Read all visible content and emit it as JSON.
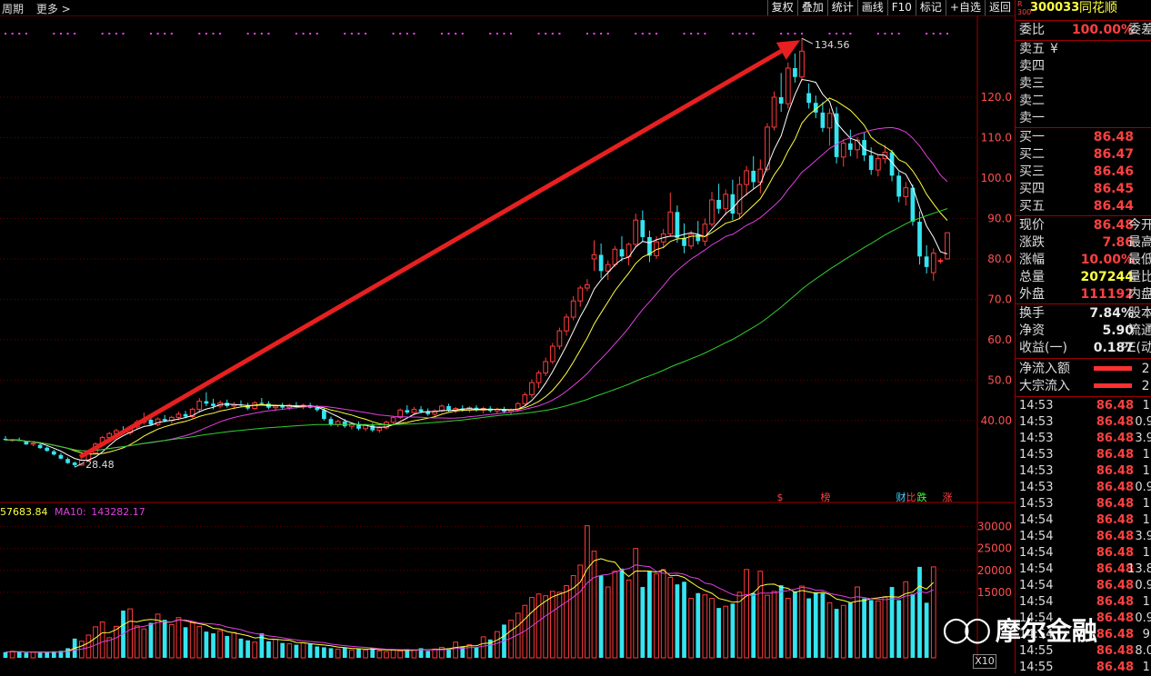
{
  "toolbar": {
    "left_items": [
      "周期",
      "更多 >"
    ],
    "buttons": [
      "复权",
      "叠加",
      "统计",
      "画线",
      "F10",
      "标记",
      "+自选",
      "返回"
    ]
  },
  "stock": {
    "badge_top": "R",
    "badge_bottom": "300",
    "code": "300033",
    "name": "同花顺"
  },
  "panel": {
    "weibi_label": "委比",
    "weibi_value": "100.00%",
    "weicha_label": "委差",
    "sell_labels": [
      "卖五",
      "卖四",
      "卖三",
      "卖二",
      "卖一"
    ],
    "sell_currency": "¥",
    "buy": [
      {
        "label": "买一",
        "price": "86.48"
      },
      {
        "label": "买二",
        "price": "86.47"
      },
      {
        "label": "买三",
        "price": "86.46"
      },
      {
        "label": "买四",
        "price": "86.45"
      },
      {
        "label": "买五",
        "price": "86.44"
      }
    ],
    "quote": [
      {
        "label": "现价",
        "value": "86.48",
        "tail": "今开"
      },
      {
        "label": "涨跌",
        "value": "7.86",
        "tail": "最高"
      },
      {
        "label": "涨幅",
        "value": "10.00%",
        "tail": "最低"
      },
      {
        "label": "总量",
        "value": "207244",
        "tail": "量比"
      },
      {
        "label": "外盘",
        "value": "111192",
        "tail": "内盘"
      }
    ],
    "fin": [
      {
        "label": "换手",
        "value": "7.84%",
        "tail": "股本"
      },
      {
        "label": "净资",
        "value": "5.90",
        "tail": "流通"
      },
      {
        "label": "收益(一)",
        "value": "0.187",
        "tail": "PE(动"
      }
    ],
    "flow": [
      {
        "label": "净流入额",
        "tail": "2."
      },
      {
        "label": "大宗流入",
        "tail": "2."
      }
    ],
    "ticks": [
      {
        "time": "14:53",
        "price": "86.48",
        "vol": "1."
      },
      {
        "time": "14:53",
        "price": "86.48",
        "vol": "0.9"
      },
      {
        "time": "14:53",
        "price": "86.48",
        "vol": "3.9"
      },
      {
        "time": "14:53",
        "price": "86.48",
        "vol": "1."
      },
      {
        "time": "14:53",
        "price": "86.48",
        "vol": "1."
      },
      {
        "time": "14:53",
        "price": "86.48",
        "vol": "0.9"
      },
      {
        "time": "14:53",
        "price": "86.48",
        "vol": "1."
      },
      {
        "time": "14:54",
        "price": "86.48",
        "vol": "1."
      },
      {
        "time": "14:54",
        "price": "86.48",
        "vol": "3.9"
      },
      {
        "time": "14:54",
        "price": "86.48",
        "vol": "1."
      },
      {
        "time": "14:54",
        "price": "86.48",
        "vol": "13.8"
      },
      {
        "time": "14:54",
        "price": "86.48",
        "vol": "0.9"
      },
      {
        "time": "14:54",
        "price": "86.48",
        "vol": "1."
      },
      {
        "time": "14:54",
        "price": "86.48",
        "vol": "0.9"
      },
      {
        "time": "14:54",
        "price": "86.48",
        "vol": "9."
      },
      {
        "time": "14:55",
        "price": "86.48",
        "vol": "8.0"
      },
      {
        "time": "14:55",
        "price": "86.48",
        "vol": "1."
      }
    ]
  },
  "colors": {
    "up": "#ff3b3b",
    "down": "#34e5f0",
    "ma5": "#ffffff",
    "ma10": "#ffff3c",
    "ma20": "#e040e0",
    "ma60": "#30d030",
    "arrow": "#e62020",
    "grid": "#6a0000"
  },
  "chart_data": {
    "type": "candlestick",
    "price_axis": {
      "ticks": [
        "120.0",
        "110.0",
        "100.0",
        "90.0",
        "80.0",
        "70.0",
        "60.0",
        "50.0",
        "40.00"
      ],
      "range": [
        22,
        140
      ]
    },
    "volume_axis": {
      "ticks": [
        "30000",
        "25000",
        "20000",
        "15000"
      ],
      "range": [
        0,
        32000
      ]
    },
    "annotations": {
      "high": "134.56",
      "low": "28.48"
    },
    "event_markers": [
      "$",
      "榜",
      "财",
      "比",
      "跌",
      "涨"
    ],
    "volume_legend": [
      {
        "name": "",
        "value": "57683.84"
      },
      {
        "name": "MA10:",
        "value": "143282.17"
      }
    ],
    "volume_multiplier": "X10",
    "candles": [
      {
        "o": 35.5,
        "h": 36.2,
        "l": 35.0,
        "c": 35.2
      },
      {
        "o": 35.1,
        "h": 35.5,
        "l": 34.8,
        "c": 35.3
      },
      {
        "o": 35.2,
        "h": 35.8,
        "l": 34.9,
        "c": 35.0
      },
      {
        "o": 34.8,
        "h": 35.0,
        "l": 34.0,
        "c": 34.1
      },
      {
        "o": 34.2,
        "h": 34.6,
        "l": 33.7,
        "c": 34.4
      },
      {
        "o": 34.0,
        "h": 34.3,
        "l": 33.0,
        "c": 33.2
      },
      {
        "o": 33.3,
        "h": 33.6,
        "l": 32.3,
        "c": 32.5
      },
      {
        "o": 32.4,
        "h": 32.8,
        "l": 31.4,
        "c": 31.6
      },
      {
        "o": 31.5,
        "h": 32.0,
        "l": 30.4,
        "c": 30.6
      },
      {
        "o": 30.5,
        "h": 30.9,
        "l": 29.3,
        "c": 29.5
      },
      {
        "o": 29.6,
        "h": 29.9,
        "l": 28.48,
        "c": 29.0
      },
      {
        "o": 29.0,
        "h": 30.5,
        "l": 28.8,
        "c": 30.2
      },
      {
        "o": 30.2,
        "h": 32.4,
        "l": 30.0,
        "c": 32.1
      },
      {
        "o": 32.0,
        "h": 34.6,
        "l": 31.8,
        "c": 34.2
      },
      {
        "o": 34.2,
        "h": 36.2,
        "l": 33.6,
        "c": 35.8
      },
      {
        "o": 35.8,
        "h": 37.2,
        "l": 35.0,
        "c": 36.8
      },
      {
        "o": 36.8,
        "h": 38.0,
        "l": 36.0,
        "c": 37.5
      },
      {
        "o": 37.5,
        "h": 38.6,
        "l": 36.6,
        "c": 37.0
      },
      {
        "o": 37.0,
        "h": 38.8,
        "l": 36.4,
        "c": 38.4
      },
      {
        "o": 38.4,
        "h": 40.2,
        "l": 37.8,
        "c": 39.6
      },
      {
        "o": 39.6,
        "h": 42.0,
        "l": 39.0,
        "c": 40.2
      },
      {
        "o": 40.2,
        "h": 41.0,
        "l": 38.8,
        "c": 39.0
      },
      {
        "o": 39.0,
        "h": 40.8,
        "l": 38.6,
        "c": 40.4
      },
      {
        "o": 40.4,
        "h": 41.4,
        "l": 39.6,
        "c": 40.0
      },
      {
        "o": 40.0,
        "h": 41.2,
        "l": 39.2,
        "c": 40.8
      },
      {
        "o": 40.8,
        "h": 42.2,
        "l": 40.2,
        "c": 41.6
      },
      {
        "o": 41.6,
        "h": 42.4,
        "l": 40.6,
        "c": 41.0
      },
      {
        "o": 41.0,
        "h": 43.2,
        "l": 40.6,
        "c": 42.8
      },
      {
        "o": 42.8,
        "h": 45.6,
        "l": 42.0,
        "c": 44.8
      },
      {
        "o": 44.8,
        "h": 47.0,
        "l": 43.6,
        "c": 44.2
      },
      {
        "o": 44.2,
        "h": 45.4,
        "l": 42.8,
        "c": 43.6
      },
      {
        "o": 43.6,
        "h": 45.0,
        "l": 43.0,
        "c": 44.4
      },
      {
        "o": 44.4,
        "h": 45.2,
        "l": 43.2,
        "c": 43.6
      },
      {
        "o": 43.6,
        "h": 44.6,
        "l": 42.8,
        "c": 44.0
      },
      {
        "o": 44.0,
        "h": 45.0,
        "l": 43.4,
        "c": 43.8
      },
      {
        "o": 43.8,
        "h": 44.4,
        "l": 42.6,
        "c": 43.0
      },
      {
        "o": 43.0,
        "h": 44.8,
        "l": 42.6,
        "c": 44.4
      },
      {
        "o": 44.4,
        "h": 45.6,
        "l": 43.8,
        "c": 44.2
      },
      {
        "o": 44.2,
        "h": 44.8,
        "l": 42.8,
        "c": 43.2
      },
      {
        "o": 43.2,
        "h": 44.0,
        "l": 42.4,
        "c": 43.6
      },
      {
        "o": 43.6,
        "h": 44.4,
        "l": 42.8,
        "c": 43.2
      },
      {
        "o": 43.2,
        "h": 44.2,
        "l": 42.6,
        "c": 43.8
      },
      {
        "o": 43.8,
        "h": 44.6,
        "l": 43.0,
        "c": 43.4
      },
      {
        "o": 43.4,
        "h": 44.2,
        "l": 42.8,
        "c": 43.8
      },
      {
        "o": 43.8,
        "h": 44.4,
        "l": 43.0,
        "c": 43.2
      },
      {
        "o": 43.2,
        "h": 43.8,
        "l": 42.2,
        "c": 42.6
      },
      {
        "o": 42.6,
        "h": 43.0,
        "l": 40.0,
        "c": 40.4
      },
      {
        "o": 40.4,
        "h": 41.0,
        "l": 38.6,
        "c": 39.0
      },
      {
        "o": 39.0,
        "h": 40.2,
        "l": 38.4,
        "c": 39.8
      },
      {
        "o": 39.8,
        "h": 40.4,
        "l": 38.2,
        "c": 38.6
      },
      {
        "o": 38.6,
        "h": 39.6,
        "l": 37.8,
        "c": 39.2
      },
      {
        "o": 39.2,
        "h": 39.8,
        "l": 37.6,
        "c": 38.0
      },
      {
        "o": 38.0,
        "h": 39.2,
        "l": 37.4,
        "c": 38.8
      },
      {
        "o": 38.8,
        "h": 39.4,
        "l": 37.2,
        "c": 37.6
      },
      {
        "o": 37.6,
        "h": 38.6,
        "l": 37.0,
        "c": 38.2
      },
      {
        "o": 38.2,
        "h": 40.0,
        "l": 37.8,
        "c": 39.6
      },
      {
        "o": 39.6,
        "h": 41.2,
        "l": 39.0,
        "c": 40.8
      },
      {
        "o": 40.8,
        "h": 43.0,
        "l": 40.4,
        "c": 42.6
      },
      {
        "o": 42.6,
        "h": 43.8,
        "l": 41.6,
        "c": 42.0
      },
      {
        "o": 42.0,
        "h": 43.4,
        "l": 41.4,
        "c": 42.8
      },
      {
        "o": 42.8,
        "h": 43.6,
        "l": 41.8,
        "c": 42.2
      },
      {
        "o": 42.2,
        "h": 43.0,
        "l": 41.2,
        "c": 41.6
      },
      {
        "o": 41.6,
        "h": 42.8,
        "l": 41.0,
        "c": 42.4
      },
      {
        "o": 42.4,
        "h": 44.0,
        "l": 42.0,
        "c": 43.6
      },
      {
        "o": 43.6,
        "h": 44.2,
        "l": 42.2,
        "c": 42.6
      },
      {
        "o": 42.6,
        "h": 43.4,
        "l": 41.8,
        "c": 43.0
      },
      {
        "o": 43.0,
        "h": 43.8,
        "l": 42.2,
        "c": 42.6
      },
      {
        "o": 42.6,
        "h": 43.6,
        "l": 42.0,
        "c": 43.2
      },
      {
        "o": 43.2,
        "h": 43.8,
        "l": 42.2,
        "c": 42.6
      },
      {
        "o": 42.6,
        "h": 43.4,
        "l": 41.8,
        "c": 43.0
      },
      {
        "o": 43.0,
        "h": 43.6,
        "l": 42.0,
        "c": 42.4
      },
      {
        "o": 42.4,
        "h": 43.2,
        "l": 41.6,
        "c": 42.8
      },
      {
        "o": 42.8,
        "h": 43.4,
        "l": 41.8,
        "c": 42.2
      },
      {
        "o": 42.2,
        "h": 43.0,
        "l": 41.4,
        "c": 42.6
      },
      {
        "o": 42.6,
        "h": 44.6,
        "l": 42.2,
        "c": 44.2
      },
      {
        "o": 44.2,
        "h": 47.0,
        "l": 43.8,
        "c": 46.4
      },
      {
        "o": 46.4,
        "h": 50.2,
        "l": 45.6,
        "c": 49.4
      },
      {
        "o": 49.4,
        "h": 52.4,
        "l": 48.0,
        "c": 51.8
      },
      {
        "o": 51.8,
        "h": 55.6,
        "l": 51.0,
        "c": 54.6
      },
      {
        "o": 54.6,
        "h": 59.2,
        "l": 54.0,
        "c": 58.4
      },
      {
        "o": 58.4,
        "h": 63.0,
        "l": 57.6,
        "c": 62.2
      },
      {
        "o": 62.2,
        "h": 66.4,
        "l": 61.0,
        "c": 65.6
      },
      {
        "o": 65.6,
        "h": 70.8,
        "l": 64.8,
        "c": 69.6
      },
      {
        "o": 69.6,
        "h": 73.4,
        "l": 68.2,
        "c": 72.8
      },
      {
        "o": 72.8,
        "h": 75.0,
        "l": 72.0,
        "c": 73.6
      },
      {
        "o": 80.0,
        "h": 84.6,
        "l": 77.0,
        "c": 81.0
      },
      {
        "o": 81.0,
        "h": 83.8,
        "l": 75.2,
        "c": 77.0
      },
      {
        "o": 77.0,
        "h": 79.6,
        "l": 74.8,
        "c": 78.6
      },
      {
        "o": 78.6,
        "h": 83.2,
        "l": 78.0,
        "c": 82.4
      },
      {
        "o": 82.4,
        "h": 85.6,
        "l": 79.4,
        "c": 80.6
      },
      {
        "o": 80.6,
        "h": 84.0,
        "l": 78.4,
        "c": 83.6
      },
      {
        "o": 83.6,
        "h": 91.2,
        "l": 82.8,
        "c": 89.6
      },
      {
        "o": 89.6,
        "h": 92.0,
        "l": 84.2,
        "c": 85.4
      },
      {
        "o": 85.4,
        "h": 87.0,
        "l": 79.2,
        "c": 80.8
      },
      {
        "o": 80.8,
        "h": 85.6,
        "l": 80.0,
        "c": 84.2
      },
      {
        "o": 84.2,
        "h": 87.4,
        "l": 82.6,
        "c": 86.2
      },
      {
        "o": 86.2,
        "h": 96.4,
        "l": 85.6,
        "c": 91.6
      },
      {
        "o": 91.6,
        "h": 93.2,
        "l": 84.0,
        "c": 85.2
      },
      {
        "o": 85.2,
        "h": 88.8,
        "l": 81.4,
        "c": 83.2
      },
      {
        "o": 83.2,
        "h": 87.0,
        "l": 82.4,
        "c": 86.0
      },
      {
        "o": 86.0,
        "h": 89.4,
        "l": 83.6,
        "c": 84.4
      },
      {
        "o": 84.4,
        "h": 90.0,
        "l": 83.2,
        "c": 88.6
      },
      {
        "o": 88.6,
        "h": 96.6,
        "l": 88.0,
        "c": 94.6
      },
      {
        "o": 94.6,
        "h": 98.6,
        "l": 91.2,
        "c": 92.4
      },
      {
        "o": 92.4,
        "h": 97.2,
        "l": 90.8,
        "c": 96.0
      },
      {
        "o": 96.0,
        "h": 99.6,
        "l": 89.6,
        "c": 91.2
      },
      {
        "o": 91.2,
        "h": 100.4,
        "l": 89.8,
        "c": 98.4
      },
      {
        "o": 98.4,
        "h": 103.0,
        "l": 95.6,
        "c": 101.8
      },
      {
        "o": 101.8,
        "h": 105.4,
        "l": 97.4,
        "c": 99.0
      },
      {
        "o": 99.0,
        "h": 104.6,
        "l": 96.2,
        "c": 102.2
      },
      {
        "o": 102.2,
        "h": 113.6,
        "l": 101.6,
        "c": 112.6
      },
      {
        "o": 112.6,
        "h": 121.4,
        "l": 111.8,
        "c": 120.0
      },
      {
        "o": 120.0,
        "h": 126.0,
        "l": 116.4,
        "c": 118.4
      },
      {
        "o": 118.4,
        "h": 128.6,
        "l": 117.2,
        "c": 127.2
      },
      {
        "o": 127.2,
        "h": 130.8,
        "l": 123.6,
        "c": 125.0
      },
      {
        "o": 125.0,
        "h": 134.56,
        "l": 124.0,
        "c": 131.4
      },
      {
        "o": 121.0,
        "h": 123.4,
        "l": 117.2,
        "c": 118.6
      },
      {
        "o": 118.6,
        "h": 120.4,
        "l": 114.8,
        "c": 116.2
      },
      {
        "o": 116.2,
        "h": 118.8,
        "l": 111.4,
        "c": 112.4
      },
      {
        "o": 112.4,
        "h": 117.2,
        "l": 108.0,
        "c": 116.0
      },
      {
        "o": 116.0,
        "h": 117.6,
        "l": 103.6,
        "c": 105.2
      },
      {
        "o": 105.2,
        "h": 109.6,
        "l": 102.8,
        "c": 108.6
      },
      {
        "o": 108.6,
        "h": 112.0,
        "l": 105.4,
        "c": 107.0
      },
      {
        "o": 107.0,
        "h": 110.2,
        "l": 104.8,
        "c": 109.4
      },
      {
        "o": 109.4,
        "h": 111.2,
        "l": 104.2,
        "c": 105.6
      },
      {
        "o": 105.6,
        "h": 107.6,
        "l": 100.8,
        "c": 102.0
      },
      {
        "o": 102.0,
        "h": 105.8,
        "l": 100.4,
        "c": 104.8
      },
      {
        "o": 104.8,
        "h": 108.2,
        "l": 103.6,
        "c": 106.4
      },
      {
        "o": 106.4,
        "h": 107.0,
        "l": 99.2,
        "c": 100.6
      },
      {
        "o": 100.6,
        "h": 101.6,
        "l": 94.0,
        "c": 95.4
      },
      {
        "o": 95.4,
        "h": 99.0,
        "l": 93.2,
        "c": 97.6
      },
      {
        "o": 97.6,
        "h": 98.4,
        "l": 88.2,
        "c": 89.2
      },
      {
        "o": 89.2,
        "h": 91.8,
        "l": 78.6,
        "c": 80.6
      },
      {
        "o": 80.6,
        "h": 83.4,
        "l": 76.4,
        "c": 78.0
      },
      {
        "o": 76.6,
        "h": 82.6,
        "l": 74.6,
        "c": 81.4
      },
      {
        "o": 79.4,
        "h": 80.2,
        "l": 78.8,
        "c": 79.6
      },
      {
        "o": 80.0,
        "h": 86.48,
        "l": 79.8,
        "c": 86.48
      }
    ],
    "volume": [
      1300,
      1500,
      1400,
      1200,
      1300,
      1200,
      1300,
      1500,
      1600,
      2200,
      4400,
      3800,
      5200,
      7100,
      8200,
      4600,
      7200,
      10800,
      11200,
      7300,
      6600,
      8000,
      10000,
      8700,
      7600,
      9200,
      7000,
      8000,
      7200,
      6000,
      5600,
      6200,
      5000,
      5800,
      4400,
      4000,
      3600,
      5600,
      3800,
      4200,
      3400,
      3200,
      3000,
      3400,
      3200,
      2600,
      2400,
      2200,
      2000,
      2400,
      1800,
      2000,
      1800,
      2200,
      1600,
      1400,
      1800,
      1600,
      2000,
      1800,
      2200,
      1600,
      2000,
      2400,
      2200,
      3600,
      2600,
      3000,
      2400,
      4800,
      4200,
      6000,
      7600,
      8600,
      10200,
      12000,
      13800,
      14600,
      14200,
      15200,
      15000,
      16500,
      18800,
      21200,
      30200,
      24400,
      18800,
      16200,
      19800,
      20400,
      17800,
      25000,
      16200,
      19800,
      19200,
      20200,
      18400,
      16800,
      17400,
      13600,
      14800,
      14400,
      13600,
      11400,
      11800,
      12400,
      15000,
      20200,
      14800,
      19800,
      14300,
      15200,
      16600,
      13600,
      15200,
      16400,
      13600,
      15000,
      14800,
      12600,
      11200,
      12000,
      12600,
      16200,
      13600,
      13200,
      13000,
      13800,
      16200,
      13200,
      17400,
      14600,
      20800,
      12600,
      20800
    ]
  }
}
